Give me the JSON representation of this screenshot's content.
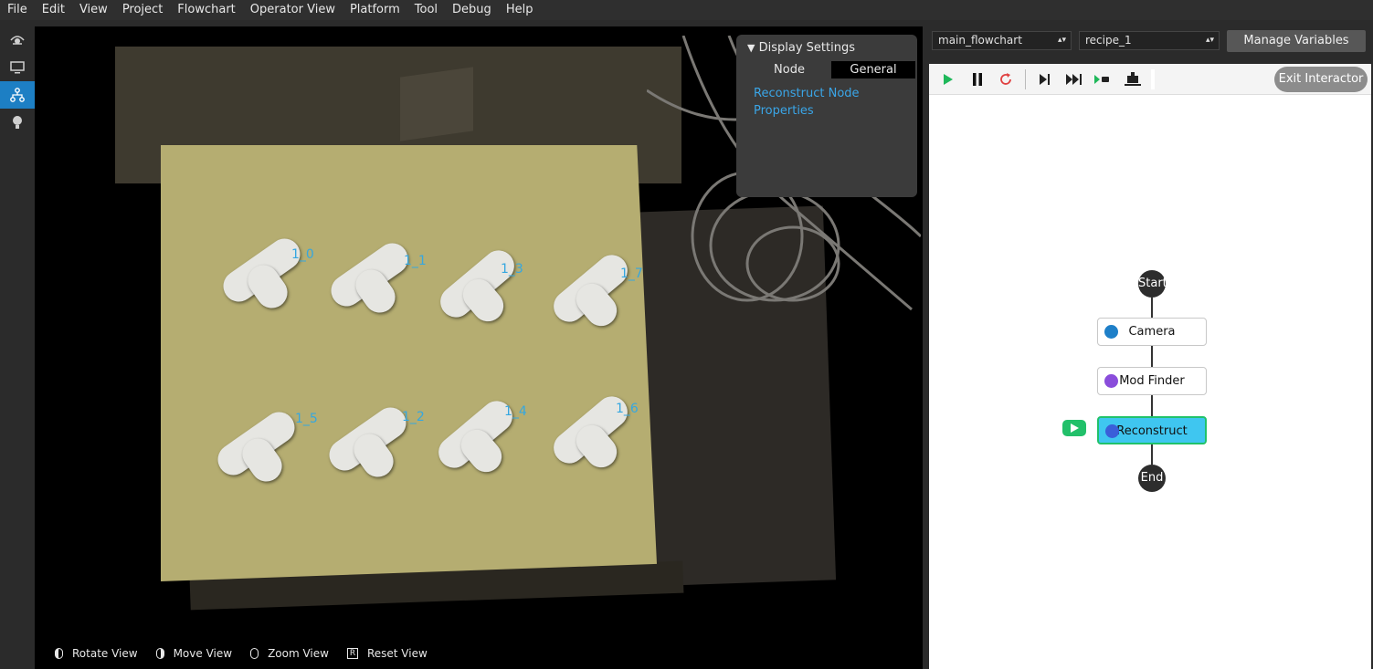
{
  "menu": [
    "File",
    "Edit",
    "View",
    "Project",
    "Flowchart",
    "Operator View",
    "Platform",
    "Tool",
    "Debug",
    "Help"
  ],
  "rail": [
    {
      "icon": "eye-icon",
      "active": false
    },
    {
      "icon": "monitor-icon",
      "active": false
    },
    {
      "icon": "flowchart-icon",
      "active": true
    },
    {
      "icon": "lightbulb-icon",
      "active": false
    }
  ],
  "viewport": {
    "markers": [
      "1_0",
      "1_1",
      "1_3",
      "1_7",
      "1_5",
      "1_2",
      "1_4",
      "1_6"
    ],
    "controls": [
      {
        "icon": "mouse-left-icon",
        "label": "Rotate View"
      },
      {
        "icon": "mouse-right-icon",
        "label": "Move View"
      },
      {
        "icon": "mouse-wheel-icon",
        "label": "Zoom View"
      },
      {
        "icon": "reset-key-icon",
        "label": "Reset View"
      }
    ],
    "reset_key": "R"
  },
  "display_settings": {
    "title": "Display Settings",
    "tabs": [
      "Node",
      "General"
    ],
    "selected_tab": "General",
    "link": "Reconstruct Node Properties"
  },
  "flow_panel": {
    "flowchart_select": "main_flowchart",
    "recipe_select": "recipe_1",
    "manage_variables": "Manage Variables",
    "exit_interactor": "Exit Interactor",
    "start": "Start",
    "end": "End",
    "nodes": [
      {
        "label": "Camera",
        "icon": "camera-icon",
        "color": "#1e7fc8",
        "selected": false
      },
      {
        "label": "Mod Finder",
        "icon": "code-icon",
        "color": "#8a4ddb",
        "selected": false
      },
      {
        "label": "Reconstruct",
        "icon": "reconstruct-icon",
        "color": "#3a5fd9",
        "selected": true
      }
    ]
  }
}
